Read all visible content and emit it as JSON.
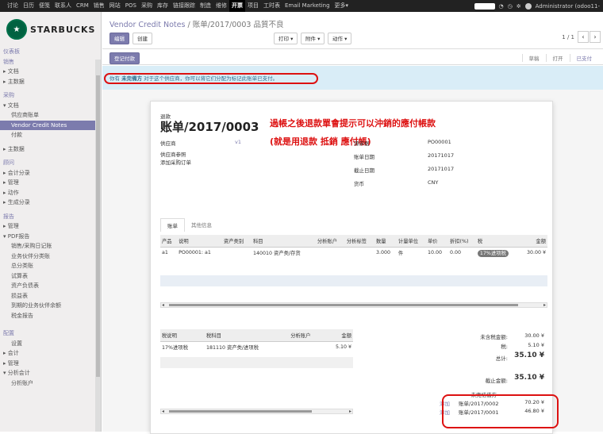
{
  "topbar": {
    "menus": [
      "讨论",
      "日历",
      "便笺",
      "联系人",
      "CRM",
      "销售",
      "网站",
      "POS",
      "采购",
      "库存",
      "链接跟踪",
      "制造",
      "维修",
      "开票",
      "项目",
      "工时表",
      "Email Marketing",
      "更多▾"
    ],
    "active_index": 13,
    "user": "Administrator (odoo11-",
    "icons": [
      "toggle-switch",
      "chat-icon",
      "clock-icon",
      "avatar"
    ]
  },
  "sidebar": {
    "logo_text": "STARBUCKS",
    "items": [
      {
        "label": "仪表板",
        "type": "head"
      },
      {
        "label": "销售",
        "type": "head"
      },
      {
        "label": "▸ 文档",
        "type": "item"
      },
      {
        "label": "▸ 主数据",
        "type": "item"
      },
      {
        "label": "",
        "type": "gap"
      },
      {
        "label": "采购",
        "type": "head"
      },
      {
        "label": "▾ 文档",
        "type": "item"
      },
      {
        "label": "供应商账单",
        "type": "sub"
      },
      {
        "label": "Vendor Credit Notes",
        "type": "sub",
        "active": true
      },
      {
        "label": "付款",
        "type": "sub"
      },
      {
        "label": "",
        "type": "gap"
      },
      {
        "label": "▸ 主数据",
        "type": "item"
      },
      {
        "label": "",
        "type": "gap"
      },
      {
        "label": "顾问",
        "type": "head"
      },
      {
        "label": "▸ 会计分录",
        "type": "item"
      },
      {
        "label": "▸ 管理",
        "type": "item"
      },
      {
        "label": "▸ 动作",
        "type": "item"
      },
      {
        "label": "▸ 生成分录",
        "type": "item"
      },
      {
        "label": "",
        "type": "gap"
      },
      {
        "label": "报告",
        "type": "head"
      },
      {
        "label": "▸ 管理",
        "type": "item"
      },
      {
        "label": "▾ PDF报告",
        "type": "item"
      },
      {
        "label": "销售/采购日记账",
        "type": "sub"
      },
      {
        "label": "业务伙伴分类账",
        "type": "sub"
      },
      {
        "label": "总分类账",
        "type": "sub"
      },
      {
        "label": "试算表",
        "type": "sub"
      },
      {
        "label": "资产负债表",
        "type": "sub"
      },
      {
        "label": "损益表",
        "type": "sub"
      },
      {
        "label": "到期的业务伙伴余额",
        "type": "sub"
      },
      {
        "label": "税金报告",
        "type": "sub"
      },
      {
        "label": "",
        "type": "gap"
      },
      {
        "label": "",
        "type": "gap"
      },
      {
        "label": "配置",
        "type": "head"
      },
      {
        "label": "设置",
        "type": "sub"
      },
      {
        "label": "▸ 会计",
        "type": "item"
      },
      {
        "label": "▸ 管理",
        "type": "item"
      },
      {
        "label": "▾ 分析会计",
        "type": "item"
      },
      {
        "label": "分析账户",
        "type": "sub"
      }
    ]
  },
  "control": {
    "breadcrumb_link": "Vendor Credit Notes",
    "breadcrumb_sep": " / ",
    "breadcrumb_current": "账单/2017/0003 品質不良",
    "edit_label": "编辑",
    "create_label": "创建",
    "print_label": "打印 ▾",
    "attach_label": "附件 ▾",
    "action_label": "动作 ▾",
    "pager": "1 / 1",
    "prev": "‹",
    "next": "›"
  },
  "status": {
    "register_payment": "登记付款",
    "stages": [
      "草稿",
      "打开",
      "已支付"
    ]
  },
  "alert": {
    "prefix": "你有 ",
    "bold": "未完備方",
    "rest": " 对于这个供应商，你可以将它们分配为标记此账单已支付。"
  },
  "sheet": {
    "doc_type": "退款",
    "doc_number": "账单/2017/0003",
    "annotation_line1": "過帳之後退款單會提示可以沖銷的應付帳款",
    "annotation_line2": "(就是用退款 抵銷 應付帳)",
    "left_fields": [
      {
        "label": "供应商",
        "value": "v1"
      },
      {
        "label": "供应商参照",
        "value": ""
      },
      {
        "label": "添加采购订单",
        "value": ""
      }
    ],
    "right_fields": [
      {
        "label": "源单据",
        "value": "PO00001"
      },
      {
        "label": "账单日期",
        "value": "20171017"
      },
      {
        "label": "截止日期",
        "value": "20171017"
      },
      {
        "label": "货币",
        "value": "CNY"
      }
    ],
    "tabs": [
      "账单",
      "其他信息"
    ],
    "lines_headers": [
      "产品",
      "说明",
      "资产类别",
      "科目",
      "分析账户",
      "分析标签",
      "数量",
      "计量单位",
      "单价",
      "折扣(%)",
      "税",
      "金额"
    ],
    "lines": [
      [
        "a1",
        "PO00001: a1",
        "",
        "140010 资产类/存货",
        "",
        "",
        "3.000",
        "件",
        "10.00",
        "0.00",
        "17%进项税",
        "30.00 ¥"
      ]
    ],
    "tax_headers": [
      "税说明",
      "税科目",
      "分析账户",
      "金额"
    ],
    "tax_lines": [
      [
        "17%进项税",
        "181110 资产类/进项税",
        "",
        "5.10 ¥"
      ]
    ],
    "totals": {
      "untaxed_label": "未含税金额:",
      "untaxed": "30.00 ¥",
      "tax_label": "税:",
      "tax": "5.10 ¥",
      "total_label": "总计:",
      "total": "35.10 ¥",
      "due_label": "截止金额:",
      "due": "35.10 ¥",
      "outstanding_title": "未完结借方",
      "outstanding": [
        {
          "action": "添加",
          "ref": "账单/2017/0002",
          "amount": "70.20 ¥"
        },
        {
          "action": "添加",
          "ref": "账单/2017/0001",
          "amount": "46.80 ¥"
        }
      ]
    }
  },
  "colors": {
    "brand": "#7c7bad",
    "annotation": "#dd1111",
    "alert_bg": "#d9edf7"
  }
}
